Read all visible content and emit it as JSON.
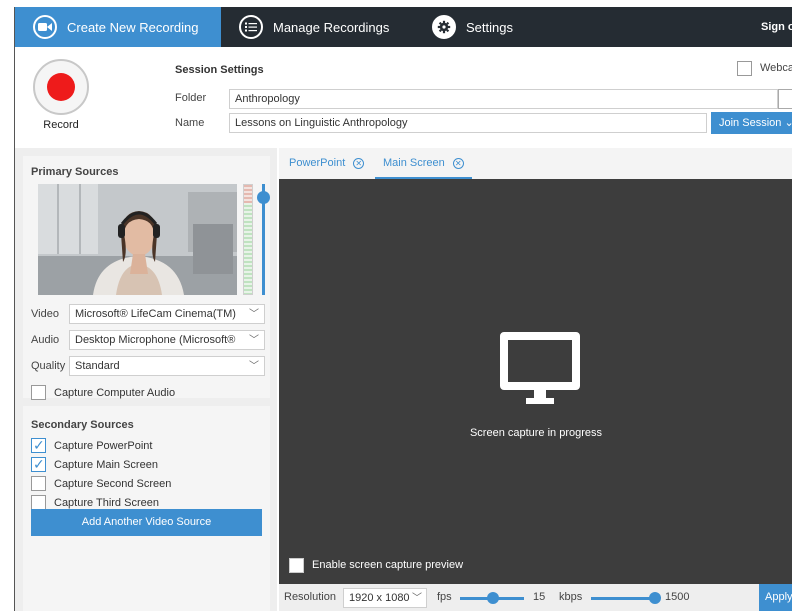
{
  "nav": {
    "tabs": [
      {
        "label": "Create New Recording",
        "icon": "camera-icon",
        "active": true
      },
      {
        "label": "Manage Recordings",
        "icon": "list-icon",
        "active": false
      },
      {
        "label": "Settings",
        "icon": "gear-icon",
        "active": false
      }
    ],
    "signout_label": "Sign out"
  },
  "record": {
    "label": "Record",
    "color": "#ee1b1b"
  },
  "session": {
    "title": "Session Settings",
    "folder_label": "Folder",
    "folder_value": "Anthropology",
    "name_label": "Name",
    "name_value": "Lessons on Linguistic Anthropology",
    "webcam_label": "Webcam",
    "join_label": "Join Session"
  },
  "primary": {
    "title": "Primary Sources",
    "video_label": "Video",
    "video_value": "Microsoft® LifeCam Cinema(TM)",
    "audio_label": "Audio",
    "audio_value": "Desktop Microphone (Microsoft®",
    "quality_label": "Quality",
    "quality_value": "Standard",
    "capture_audio_label": "Capture Computer Audio",
    "capture_audio_checked": false
  },
  "secondary": {
    "title": "Secondary Sources",
    "items": [
      {
        "label": "Capture PowerPoint",
        "checked": true
      },
      {
        "label": "Capture Main Screen",
        "checked": true
      },
      {
        "label": "Capture Second Screen",
        "checked": false
      },
      {
        "label": "Capture Third Screen",
        "checked": false
      }
    ],
    "add_label": "Add Another Video Source"
  },
  "preview": {
    "tabs": [
      {
        "label": "PowerPoint",
        "active": false
      },
      {
        "label": "Main Screen",
        "active": true
      }
    ],
    "status_text": "Screen capture in progress",
    "enable_preview_label": "Enable screen capture preview",
    "enable_preview_checked": false
  },
  "output": {
    "resolution_label": "Resolution",
    "resolution_value": "1920 x 1080",
    "fps_label": "fps",
    "fps_value": "15",
    "kbps_label": "kbps",
    "kbps_value": "1500",
    "apply_label": "Apply"
  },
  "colors": {
    "accent": "#3e8fd0",
    "nav_bg": "#252c33",
    "preview_bg": "#3d3d3d"
  }
}
